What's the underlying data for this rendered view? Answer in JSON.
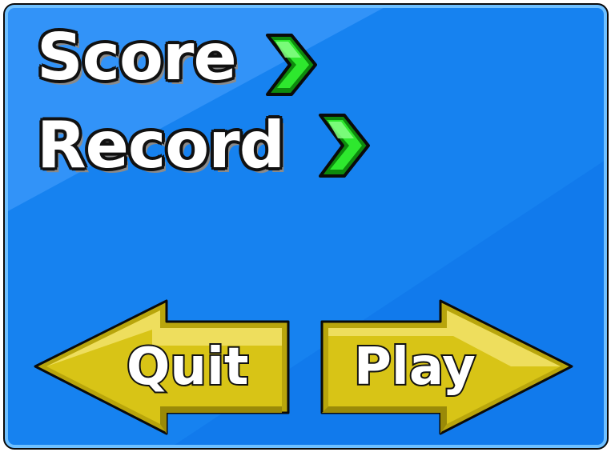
{
  "stats": {
    "score_label": "Score",
    "record_label": "Record"
  },
  "buttons": {
    "quit_label": "Quit",
    "play_label": "Play"
  },
  "icons": {
    "stat_marker": "green-chevron-right-icon",
    "quit_arrow": "left-arrow",
    "play_arrow": "right-arrow"
  },
  "colors": {
    "panel_blue": "#1682f0",
    "panel_border_light": "#6fc0ff",
    "arrow_yellow": "#d8c416",
    "chevron_green": "#22dd22"
  }
}
